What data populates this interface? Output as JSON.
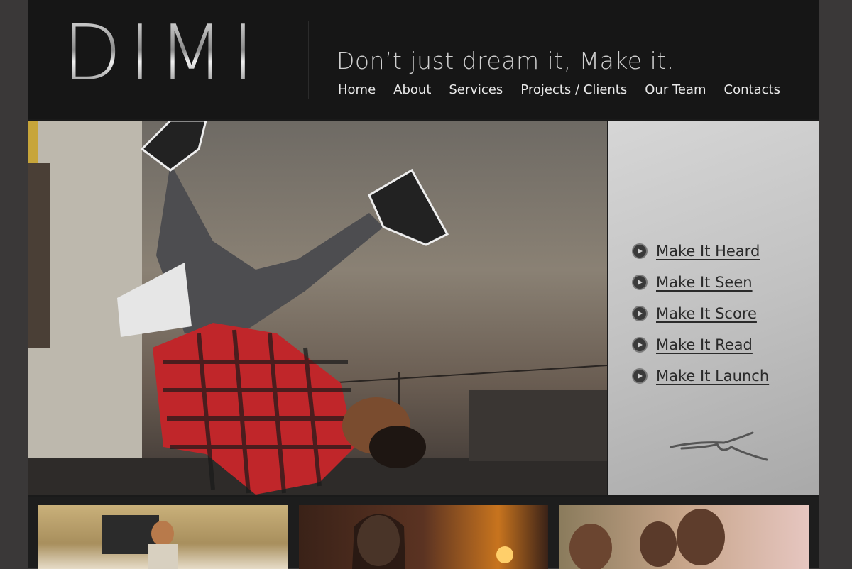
{
  "brand": {
    "logo": "DIMI",
    "tagline": "Don’t just dream it, Make it."
  },
  "nav": {
    "items": [
      {
        "label": "Home"
      },
      {
        "label": "About"
      },
      {
        "label": "Services"
      },
      {
        "label": "Projects / Clients"
      },
      {
        "label": "Our Team"
      },
      {
        "label": "Contacts"
      }
    ]
  },
  "panel": {
    "links": [
      {
        "label": "Make It Heard"
      },
      {
        "label": "Make It Seen"
      },
      {
        "label": "Make It Score"
      },
      {
        "label": "Make It Read"
      },
      {
        "label": "Make It Launch"
      }
    ]
  },
  "colors": {
    "background": "#3a3838",
    "header": "#161616",
    "nav_text": "#e8e8e8",
    "panel": "#c8c8c8",
    "shirt_red": "#c0262a"
  }
}
